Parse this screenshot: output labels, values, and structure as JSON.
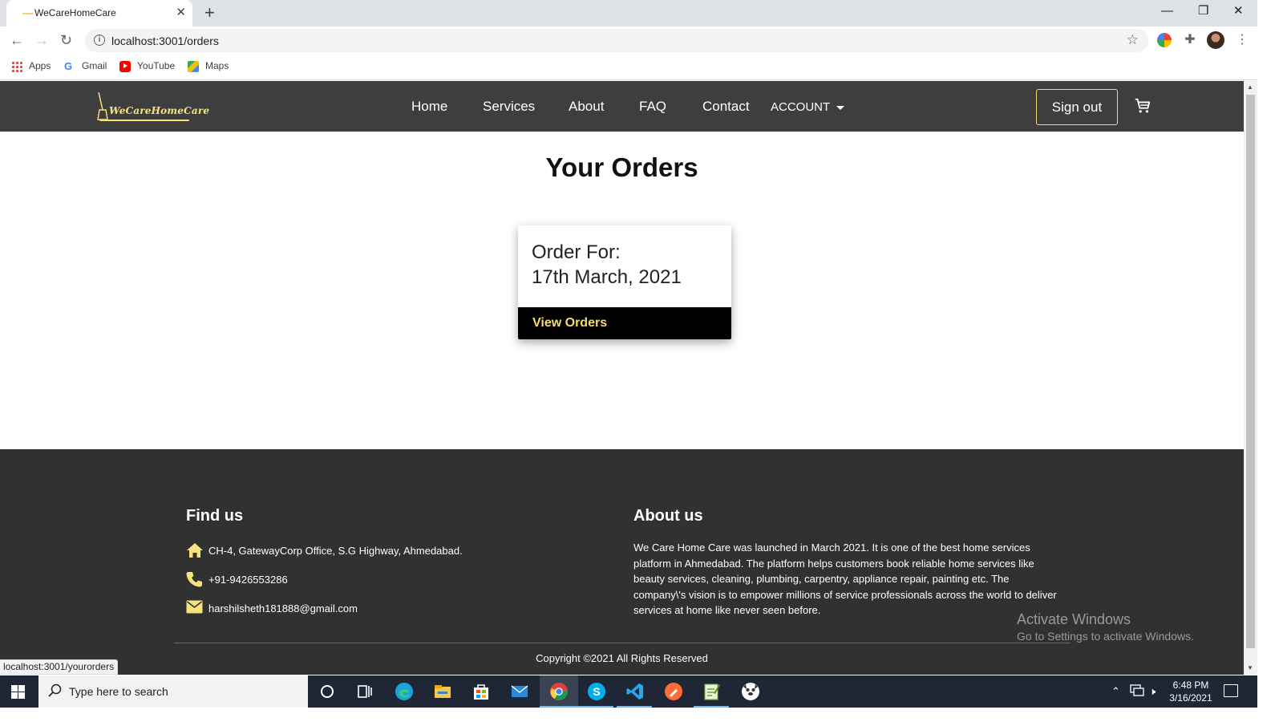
{
  "browser": {
    "tab_title": "WeCareHomeCare",
    "url": "localhost:3001/orders",
    "bookmarks": [
      "Apps",
      "Gmail",
      "YouTube",
      "Maps"
    ],
    "status_url": "localhost:3001/yourorders"
  },
  "site": {
    "logo_text": "WeCareHomeCare",
    "nav": [
      "Home",
      "Services",
      "About",
      "FAQ",
      "Contact"
    ],
    "account_label": "ACCOUNT",
    "signout_label": "Sign out",
    "brand_color": "#f4dc73",
    "nav_bg": "#3e3e3e"
  },
  "orders": {
    "title": "Your Orders",
    "card": {
      "label": "Order For:",
      "date": "17th March, 2021",
      "button": "View Orders"
    }
  },
  "footer": {
    "find_heading": "Find us",
    "address": "CH-4, GatewayCorp Office, S.G Highway, Ahmedabad.",
    "phone": "+91-9426553286",
    "email": "harshilsheth181888@gmail.com",
    "about_heading": "About us",
    "about_text": "We Care Home Care was launched in March 2021. It is one of the best home services platform in Ahmedabad. The platform helps customers book reliable home services like beauty services, cleaning, plumbing, carpentry, appliance repair, painting etc. The company\\'s vision is to empower millions of service professionals across the world to deliver services at home like never seen before.",
    "copyright": "Copyright ©2021 All Rights Reserved"
  },
  "windows": {
    "activate_title": "Activate Windows",
    "activate_sub": "Go to Settings to activate Windows.",
    "search_placeholder": "Type here to search",
    "time": "6:48 PM",
    "date": "3/16/2021"
  }
}
